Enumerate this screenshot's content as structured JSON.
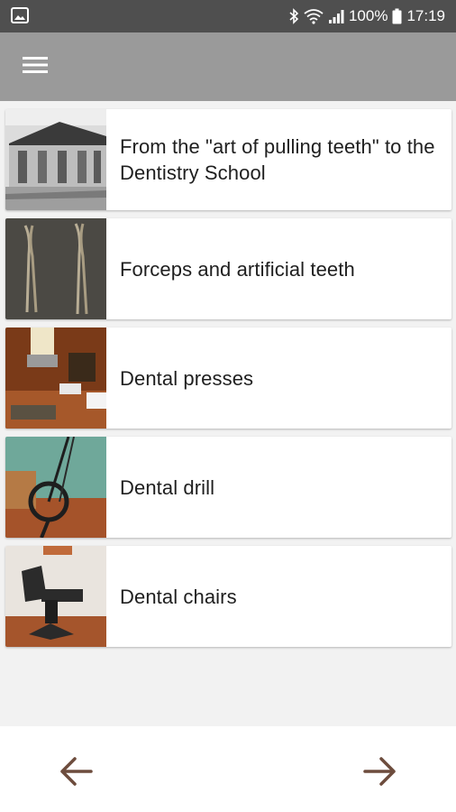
{
  "status_bar": {
    "battery_percent": "100%",
    "time": "17:19",
    "icons": [
      "gallery-icon",
      "bluetooth-icon",
      "wifi-icon",
      "signal-icon",
      "battery-icon"
    ]
  },
  "app_bar": {
    "menu_icon": "hamburger-menu-icon"
  },
  "items": [
    {
      "title": "From the \"art of pulling teeth\" to the Dentistry School",
      "image": "historic school building photo"
    },
    {
      "title": "Forceps and artificial teeth",
      "image": "dental forceps photo"
    },
    {
      "title": "Dental presses",
      "image": "dental press photo"
    },
    {
      "title": "Dental drill",
      "image": "dental drill photo"
    },
    {
      "title": "Dental chairs",
      "image": "dental chair photo"
    }
  ],
  "bottom_nav": {
    "prev_icon": "arrow-left-icon",
    "next_icon": "arrow-right-icon",
    "arrow_color": "#6d4c3d"
  }
}
